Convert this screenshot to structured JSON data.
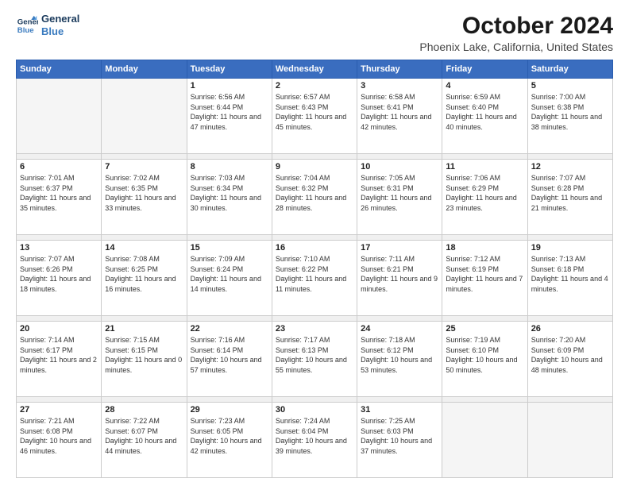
{
  "logo": {
    "line1": "General",
    "line2": "Blue"
  },
  "title": "October 2024",
  "subtitle": "Phoenix Lake, California, United States",
  "days_of_week": [
    "Sunday",
    "Monday",
    "Tuesday",
    "Wednesday",
    "Thursday",
    "Friday",
    "Saturday"
  ],
  "weeks": [
    [
      {
        "num": "",
        "sunrise": "",
        "sunset": "",
        "daylight": ""
      },
      {
        "num": "",
        "sunrise": "",
        "sunset": "",
        "daylight": ""
      },
      {
        "num": "1",
        "sunrise": "Sunrise: 6:56 AM",
        "sunset": "Sunset: 6:44 PM",
        "daylight": "Daylight: 11 hours and 47 minutes."
      },
      {
        "num": "2",
        "sunrise": "Sunrise: 6:57 AM",
        "sunset": "Sunset: 6:43 PM",
        "daylight": "Daylight: 11 hours and 45 minutes."
      },
      {
        "num": "3",
        "sunrise": "Sunrise: 6:58 AM",
        "sunset": "Sunset: 6:41 PM",
        "daylight": "Daylight: 11 hours and 42 minutes."
      },
      {
        "num": "4",
        "sunrise": "Sunrise: 6:59 AM",
        "sunset": "Sunset: 6:40 PM",
        "daylight": "Daylight: 11 hours and 40 minutes."
      },
      {
        "num": "5",
        "sunrise": "Sunrise: 7:00 AM",
        "sunset": "Sunset: 6:38 PM",
        "daylight": "Daylight: 11 hours and 38 minutes."
      }
    ],
    [
      {
        "num": "6",
        "sunrise": "Sunrise: 7:01 AM",
        "sunset": "Sunset: 6:37 PM",
        "daylight": "Daylight: 11 hours and 35 minutes."
      },
      {
        "num": "7",
        "sunrise": "Sunrise: 7:02 AM",
        "sunset": "Sunset: 6:35 PM",
        "daylight": "Daylight: 11 hours and 33 minutes."
      },
      {
        "num": "8",
        "sunrise": "Sunrise: 7:03 AM",
        "sunset": "Sunset: 6:34 PM",
        "daylight": "Daylight: 11 hours and 30 minutes."
      },
      {
        "num": "9",
        "sunrise": "Sunrise: 7:04 AM",
        "sunset": "Sunset: 6:32 PM",
        "daylight": "Daylight: 11 hours and 28 minutes."
      },
      {
        "num": "10",
        "sunrise": "Sunrise: 7:05 AM",
        "sunset": "Sunset: 6:31 PM",
        "daylight": "Daylight: 11 hours and 26 minutes."
      },
      {
        "num": "11",
        "sunrise": "Sunrise: 7:06 AM",
        "sunset": "Sunset: 6:29 PM",
        "daylight": "Daylight: 11 hours and 23 minutes."
      },
      {
        "num": "12",
        "sunrise": "Sunrise: 7:07 AM",
        "sunset": "Sunset: 6:28 PM",
        "daylight": "Daylight: 11 hours and 21 minutes."
      }
    ],
    [
      {
        "num": "13",
        "sunrise": "Sunrise: 7:07 AM",
        "sunset": "Sunset: 6:26 PM",
        "daylight": "Daylight: 11 hours and 18 minutes."
      },
      {
        "num": "14",
        "sunrise": "Sunrise: 7:08 AM",
        "sunset": "Sunset: 6:25 PM",
        "daylight": "Daylight: 11 hours and 16 minutes."
      },
      {
        "num": "15",
        "sunrise": "Sunrise: 7:09 AM",
        "sunset": "Sunset: 6:24 PM",
        "daylight": "Daylight: 11 hours and 14 minutes."
      },
      {
        "num": "16",
        "sunrise": "Sunrise: 7:10 AM",
        "sunset": "Sunset: 6:22 PM",
        "daylight": "Daylight: 11 hours and 11 minutes."
      },
      {
        "num": "17",
        "sunrise": "Sunrise: 7:11 AM",
        "sunset": "Sunset: 6:21 PM",
        "daylight": "Daylight: 11 hours and 9 minutes."
      },
      {
        "num": "18",
        "sunrise": "Sunrise: 7:12 AM",
        "sunset": "Sunset: 6:19 PM",
        "daylight": "Daylight: 11 hours and 7 minutes."
      },
      {
        "num": "19",
        "sunrise": "Sunrise: 7:13 AM",
        "sunset": "Sunset: 6:18 PM",
        "daylight": "Daylight: 11 hours and 4 minutes."
      }
    ],
    [
      {
        "num": "20",
        "sunrise": "Sunrise: 7:14 AM",
        "sunset": "Sunset: 6:17 PM",
        "daylight": "Daylight: 11 hours and 2 minutes."
      },
      {
        "num": "21",
        "sunrise": "Sunrise: 7:15 AM",
        "sunset": "Sunset: 6:15 PM",
        "daylight": "Daylight: 11 hours and 0 minutes."
      },
      {
        "num": "22",
        "sunrise": "Sunrise: 7:16 AM",
        "sunset": "Sunset: 6:14 PM",
        "daylight": "Daylight: 10 hours and 57 minutes."
      },
      {
        "num": "23",
        "sunrise": "Sunrise: 7:17 AM",
        "sunset": "Sunset: 6:13 PM",
        "daylight": "Daylight: 10 hours and 55 minutes."
      },
      {
        "num": "24",
        "sunrise": "Sunrise: 7:18 AM",
        "sunset": "Sunset: 6:12 PM",
        "daylight": "Daylight: 10 hours and 53 minutes."
      },
      {
        "num": "25",
        "sunrise": "Sunrise: 7:19 AM",
        "sunset": "Sunset: 6:10 PM",
        "daylight": "Daylight: 10 hours and 50 minutes."
      },
      {
        "num": "26",
        "sunrise": "Sunrise: 7:20 AM",
        "sunset": "Sunset: 6:09 PM",
        "daylight": "Daylight: 10 hours and 48 minutes."
      }
    ],
    [
      {
        "num": "27",
        "sunrise": "Sunrise: 7:21 AM",
        "sunset": "Sunset: 6:08 PM",
        "daylight": "Daylight: 10 hours and 46 minutes."
      },
      {
        "num": "28",
        "sunrise": "Sunrise: 7:22 AM",
        "sunset": "Sunset: 6:07 PM",
        "daylight": "Daylight: 10 hours and 44 minutes."
      },
      {
        "num": "29",
        "sunrise": "Sunrise: 7:23 AM",
        "sunset": "Sunset: 6:05 PM",
        "daylight": "Daylight: 10 hours and 42 minutes."
      },
      {
        "num": "30",
        "sunrise": "Sunrise: 7:24 AM",
        "sunset": "Sunset: 6:04 PM",
        "daylight": "Daylight: 10 hours and 39 minutes."
      },
      {
        "num": "31",
        "sunrise": "Sunrise: 7:25 AM",
        "sunset": "Sunset: 6:03 PM",
        "daylight": "Daylight: 10 hours and 37 minutes."
      },
      {
        "num": "",
        "sunrise": "",
        "sunset": "",
        "daylight": ""
      },
      {
        "num": "",
        "sunrise": "",
        "sunset": "",
        "daylight": ""
      }
    ]
  ]
}
